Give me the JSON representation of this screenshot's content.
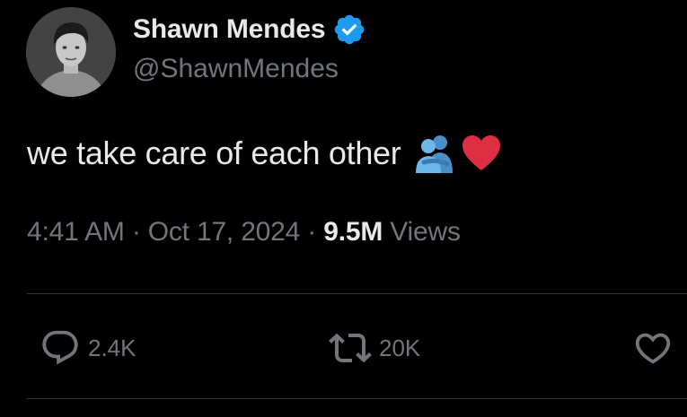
{
  "author": {
    "display_name": "Shawn Mendes",
    "handle": "@ShawnMendes",
    "verified": true,
    "verified_color": "#1d9bf0"
  },
  "tweet": {
    "text": "we take care of each other",
    "emojis": [
      "people-hugging-emoji",
      "red-heart-emoji"
    ]
  },
  "meta": {
    "time": "4:41 AM",
    "separator": "·",
    "date": "Oct 17, 2024",
    "views_count": "9.5M",
    "views_label": "Views"
  },
  "actions": {
    "reply_icon": "reply-icon",
    "reply_count": "2.4K",
    "retweet_icon": "retweet-icon",
    "retweet_count": "20K",
    "like_icon": "heart-outline-icon"
  },
  "colors": {
    "background": "#000000",
    "primary_text": "#e7e9ea",
    "secondary_text": "#71767b",
    "divider": "#2f3336",
    "heart": "#dd2e44",
    "hug_emoji": "#5dadec"
  }
}
